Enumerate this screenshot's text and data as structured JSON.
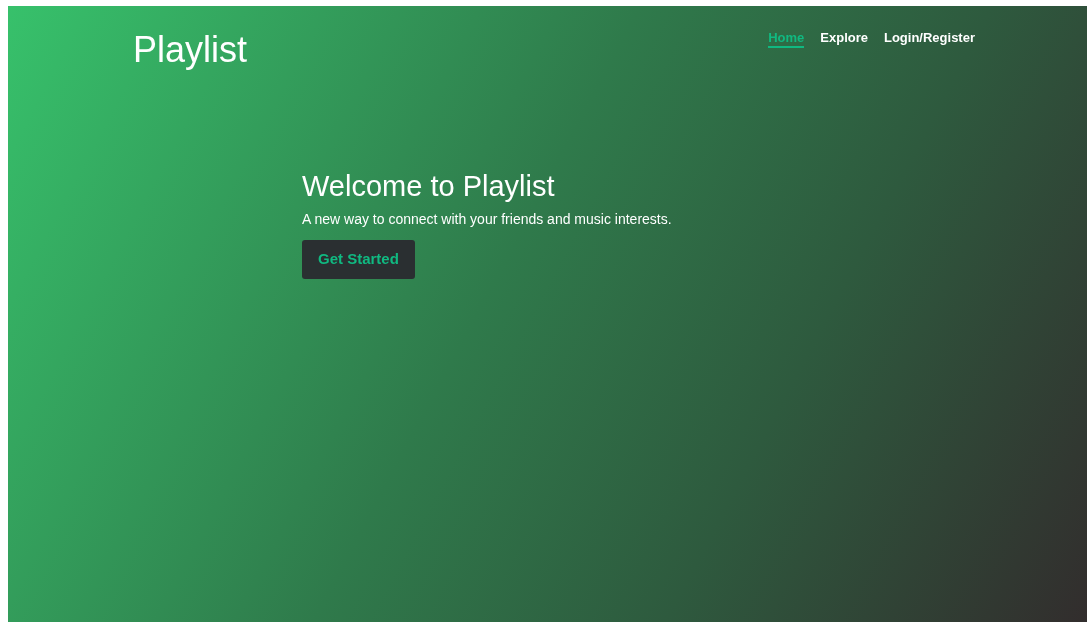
{
  "brand": "Playlist",
  "nav": [
    {
      "label": "Home",
      "selected": true
    },
    {
      "label": "Explore",
      "selected": false
    },
    {
      "label": "Login/Register",
      "selected": false
    }
  ],
  "hero": {
    "title": "Welcome to Playlist",
    "subtitle": "A new way to connect with your friends and music interests.",
    "button": "Get Started"
  }
}
